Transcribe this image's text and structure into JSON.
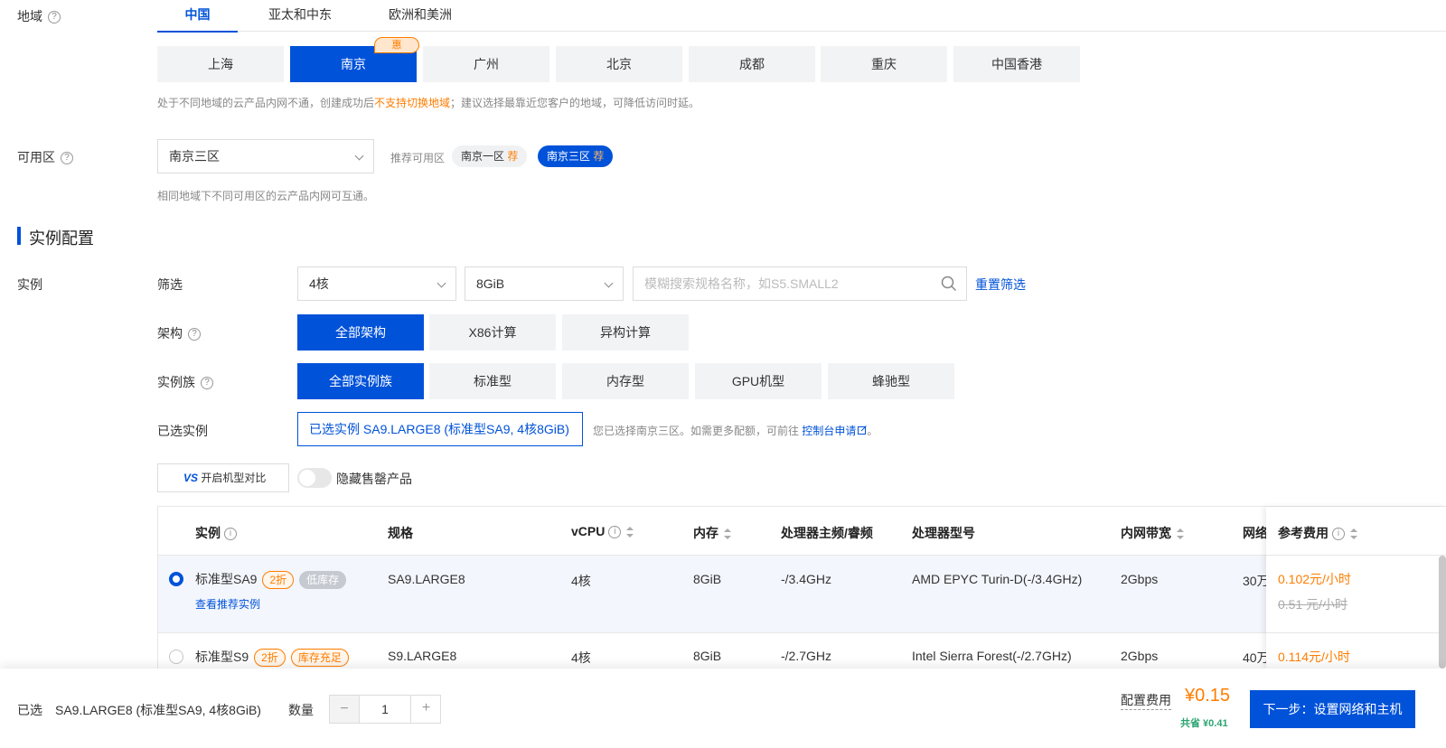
{
  "region": {
    "label": "地域",
    "tabs": [
      "中国",
      "亚太和中东",
      "欧洲和美洲"
    ],
    "cities": [
      "上海",
      "南京",
      "广州",
      "北京",
      "成都",
      "重庆",
      "中国香港"
    ],
    "promo_badge": "惠",
    "hint_prefix": "处于不同地域的云产品内网不通，创建成功后",
    "hint_highlight": "不支持切换地域",
    "hint_suffix": "；建议选择最靠近您客户的地域，可降低访问时延。"
  },
  "zone": {
    "label": "可用区",
    "selected": "南京三区",
    "recommend_label": "推荐可用区",
    "recommended": [
      "南京一区",
      "南京三区"
    ],
    "rec_mark": "荐",
    "hint": "相同地域下不同可用区的云产品内网可互通。"
  },
  "section": {
    "title": "实例配置"
  },
  "instance": {
    "label": "实例",
    "filter_label": "筛选",
    "cpu_select": "4核",
    "mem_select": "8GiB",
    "search_placeholder": "模糊搜索规格名称，如S5.SMALL2",
    "reset_filter": "重置筛选",
    "arch_label": "架构",
    "arch_options": [
      "全部架构",
      "X86计算",
      "异构计算"
    ],
    "family_label": "实例族",
    "family_options": [
      "全部实例族",
      "标准型",
      "内存型",
      "GPU机型",
      "蜂驰型"
    ],
    "selected_label": "已选实例",
    "selected_value": "已选实例  SA9.LARGE8 (标准型SA9, 4核8GiB)",
    "selected_hint": "您已选择南京三区。如需更多配额，可前往",
    "console_link": "控制台申请",
    "selected_hint_end": "。",
    "compare_button": "开启机型对比",
    "compare_logo": "VS",
    "hide_soldout": "隐藏售罄产品"
  },
  "table": {
    "headers": [
      "实例",
      "规格",
      "vCPU",
      "内存",
      "处理器主频/睿频",
      "处理器型号",
      "内网带宽",
      "网络",
      "参考费用"
    ],
    "rows": [
      {
        "name": "标准型SA9",
        "tags": [
          "2折",
          "低库存"
        ],
        "link": "查看推荐实例",
        "spec": "SA9.LARGE8",
        "vcpu": "4核",
        "mem": "8GiB",
        "freq": "-/3.4GHz",
        "cpu_model": "AMD EPYC Turin-D(-/3.4GHz)",
        "bandwidth": "2Gbps",
        "network": "30万",
        "price": "0.102元/小时",
        "orig_price": "0.51 元/小时"
      },
      {
        "name": "标准型S9",
        "tags": [
          "2折",
          "库存充足"
        ],
        "spec": "S9.LARGE8",
        "vcpu": "4核",
        "mem": "8GiB",
        "freq": "-/2.7GHz",
        "cpu_model": "Intel Sierra Forest(-/2.7GHz)",
        "bandwidth": "2Gbps",
        "network": "40万",
        "price": "0.114元/小时"
      }
    ]
  },
  "footer": {
    "selected_label": "已选",
    "selected_value": "SA9.LARGE8 (标准型SA9, 4核8GiB)",
    "qty_label": "数量",
    "qty_value": "1",
    "minus": "−",
    "plus": "+",
    "cost_label": "配置费用",
    "cost_value": "¥0.15",
    "save_text": "共省 ¥0.41",
    "next_button": "下一步：设置网络和主机"
  },
  "colors": {
    "accent": "#0052d9",
    "orange": "#ff7d00",
    "green": "#2ba471"
  }
}
